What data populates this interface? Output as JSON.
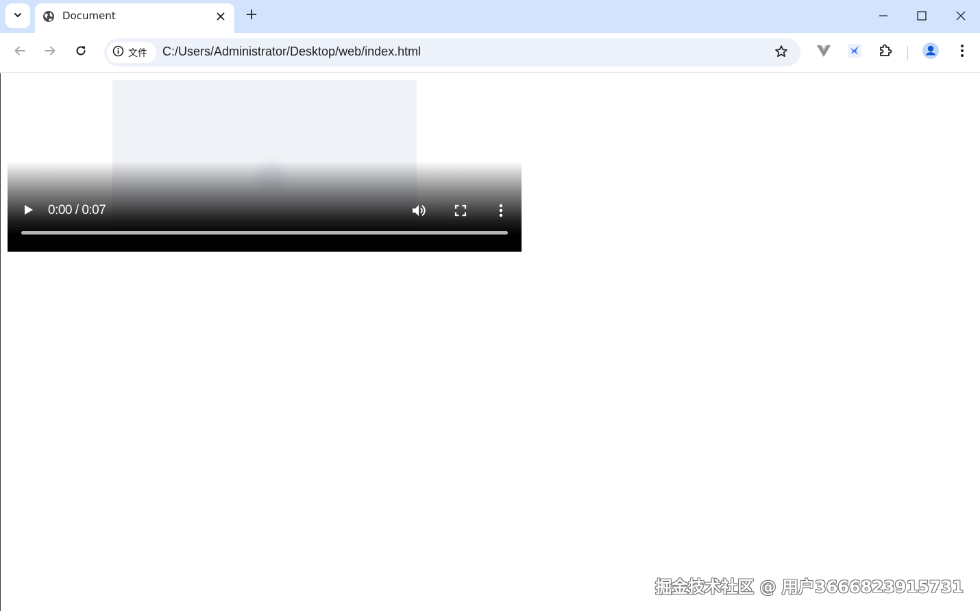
{
  "tabstrip": {
    "tab_search_icon": "chevron-down-icon",
    "active_tab": {
      "title": "Document",
      "favicon": "globe-icon",
      "close_icon": "close-icon"
    },
    "new_tab_icon": "plus-icon"
  },
  "window_controls": [
    "minimize-icon",
    "maximize-icon",
    "close-icon"
  ],
  "toolbar": {
    "back_icon": "arrow-left-icon",
    "forward_icon": "arrow-right-icon",
    "reload_icon": "reload-icon",
    "site_chip": {
      "icon": "info-icon",
      "label": "文件"
    },
    "url": "C:/Users/Administrator/Desktop/web/index.html",
    "bookmark_icon": "star-icon",
    "extensions": [
      "vue-devtools-icon",
      "bird-extension-icon",
      "puzzle-icon"
    ],
    "profile_icon": "avatar-icon",
    "menu_icon": "kebab-menu-icon"
  },
  "video": {
    "current_time": "0:00",
    "separator": " / ",
    "duration": "0:07",
    "progress": 0,
    "controls": [
      "play-icon",
      "volume-icon",
      "fullscreen-icon",
      "more-icon"
    ]
  },
  "watermark": "掘金技术社区 @ 用户3666823915731",
  "colors": {
    "tabstrip_bg": "#d3e3fd",
    "omnibox_bg": "#edf2fa",
    "accent_blue": "#0b57d0",
    "video_controls_bg": "#000000"
  }
}
